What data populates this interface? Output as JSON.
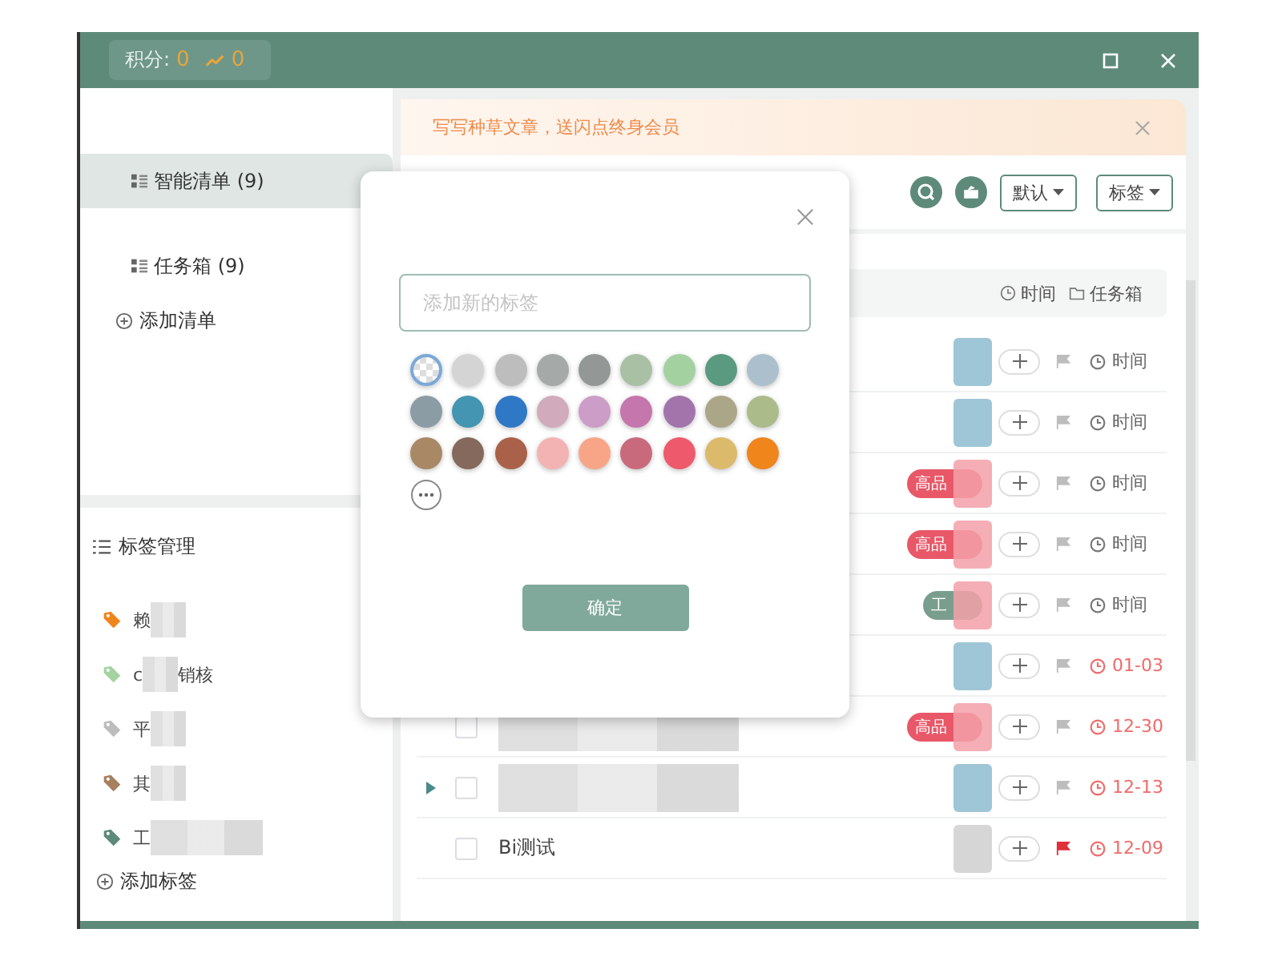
{
  "title_bar": {
    "points_label": "积分:",
    "points": "0",
    "trend": "0"
  },
  "sidebar": {
    "lists": [
      {
        "label": "智能清单 (9)",
        "selected": true
      },
      {
        "label": "任务箱 (9)",
        "selected": false
      }
    ],
    "add_list": "添加清单",
    "tags_header": "标签管理",
    "tags": [
      {
        "label": "赖",
        "color": "#f0851c"
      },
      {
        "label": "c",
        "suffix": "销核",
        "color": "#a3d3a0"
      },
      {
        "label": "平",
        "color": "#bdbdbd"
      },
      {
        "label": "其",
        "color": "#a7805f"
      },
      {
        "label": "工",
        "color": "#5e8a7a"
      }
    ],
    "add_tag": "添加标签"
  },
  "banner": {
    "text": "写写种草文章，送闪点终身会员"
  },
  "toolbar": {
    "sort": "默认",
    "filter": "标签"
  },
  "group_header": {
    "time": "时间",
    "box": "任务箱"
  },
  "rows": [
    {
      "tag": null,
      "flagged": false,
      "date": "时间",
      "overdue": false
    },
    {
      "tag": null,
      "flagged": false,
      "date": "时间",
      "overdue": false
    },
    {
      "tag": {
        "text": "高品",
        "color": "#e85868"
      },
      "flagged": false,
      "date": "时间",
      "overdue": false
    },
    {
      "tag": {
        "text": "高品",
        "color": "#e85868"
      },
      "flagged": false,
      "date": "时间",
      "overdue": false
    },
    {
      "tag": {
        "text": "工",
        "color": "#7a9e8e"
      },
      "flagged": false,
      "date": "时间",
      "overdue": false
    },
    {
      "tag": null,
      "flagged": false,
      "date": "01-03",
      "overdue": true
    },
    {
      "tag": {
        "text": "高品",
        "color": "#e85868"
      },
      "flagged": false,
      "date": "12-30",
      "overdue": true,
      "checked": false,
      "blurred_title": true
    },
    {
      "tag": null,
      "flagged": false,
      "date": "12-13",
      "overdue": true,
      "checked": false,
      "blurred_title": true,
      "expandable": true
    },
    {
      "tag": null,
      "flagged": true,
      "date": "12-09",
      "overdue": true,
      "checked": false,
      "title": "Bi测试"
    }
  ],
  "dialog": {
    "placeholder": "添加新的标签",
    "confirm": "确定",
    "swatches": [
      {
        "kind": "none",
        "selected": true
      },
      {
        "color": "#d4d4d4",
        "selected": false
      },
      {
        "color": "#bdbdbd",
        "selected": false
      },
      {
        "color": "#a5a9a8",
        "selected": false
      },
      {
        "color": "#939897",
        "selected": false
      },
      {
        "color": "#a9c0a5",
        "selected": false
      },
      {
        "color": "#a3d1a0",
        "selected": false
      },
      {
        "color": "#5a9a80",
        "selected": false
      },
      {
        "color": "#abc0cc",
        "selected": false
      },
      {
        "color": "#8b9ca5",
        "selected": false
      },
      {
        "color": "#4395b1",
        "selected": false
      },
      {
        "color": "#2f78c6",
        "selected": false
      },
      {
        "color": "#d1aabb",
        "selected": false
      },
      {
        "color": "#cc9dc6",
        "selected": false
      },
      {
        "color": "#c576ac",
        "selected": false
      },
      {
        "color": "#a374ab",
        "selected": false
      },
      {
        "color": "#aba688",
        "selected": false
      },
      {
        "color": "#abbb89",
        "selected": false
      },
      {
        "color": "#a98866",
        "selected": false
      },
      {
        "color": "#84695c",
        "selected": false
      },
      {
        "color": "#aa6149",
        "selected": false
      },
      {
        "color": "#f3b3b2",
        "selected": false
      },
      {
        "color": "#f8a587",
        "selected": false
      },
      {
        "color": "#c96a7c",
        "selected": false
      },
      {
        "color": "#ee5a6c",
        "selected": false
      },
      {
        "color": "#dbba6b",
        "selected": false
      },
      {
        "color": "#f0851c",
        "selected": false
      }
    ]
  }
}
